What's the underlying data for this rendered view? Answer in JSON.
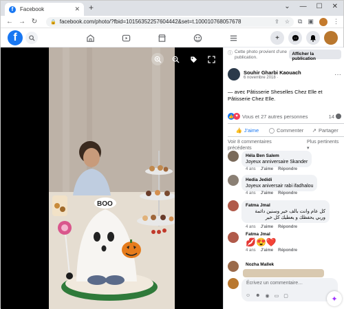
{
  "browser": {
    "tab_title": "Facebook",
    "url": "facebook.com/photo/?fbid=10156352257604442&set=t.100010768057678"
  },
  "photo_notice": {
    "text": "Cette photo provient d'une publication.",
    "button": "Afficher la publication"
  },
  "post": {
    "author": "Souhir Gharbi Kaouach",
    "date": "6 novembre 2018 ·",
    "caption": "— avec Pâtisserie Sheselles Chez Elle et Pâtisserie Chez Elle.",
    "reactions_text": "Vous et 27 autres personnes",
    "comment_count": "14",
    "cake_text": "BOO"
  },
  "actions": {
    "like": "J'aime",
    "comment": "Commenter",
    "share": "Partager"
  },
  "comments_header": {
    "previous": "Voir 8 commentaires précédents",
    "relevant": "Plus pertinents ▾"
  },
  "comments": [
    {
      "name": "Héla Ben Salem",
      "text": "Joyeux anniversaire Skander",
      "time": "4 ans",
      "like": "J'aime",
      "reply": "Répondre"
    },
    {
      "name": "Hedia Jedidi",
      "text": "Joyeux aniversair rabi ifadhalou",
      "time": "4 ans",
      "like": "J'aime",
      "reply": "Répondre"
    },
    {
      "name": "Fatma Jmal",
      "text": "كل عام وانت بالف خير وسنين دائمة وربي يحفظك و يعطيك كل خير",
      "time": "4 ans",
      "like": "J'aime",
      "reply": "Répondre"
    },
    {
      "name": "Fatma Jmal",
      "text": "💋😍❤️",
      "time": "4 ans",
      "like": "J'aime",
      "reply": "Répondre"
    },
    {
      "name": "Nozha Mallek",
      "text": "",
      "time": "",
      "like": "",
      "reply": ""
    }
  ],
  "compose": {
    "placeholder": "Écrivez un commentaire…"
  }
}
